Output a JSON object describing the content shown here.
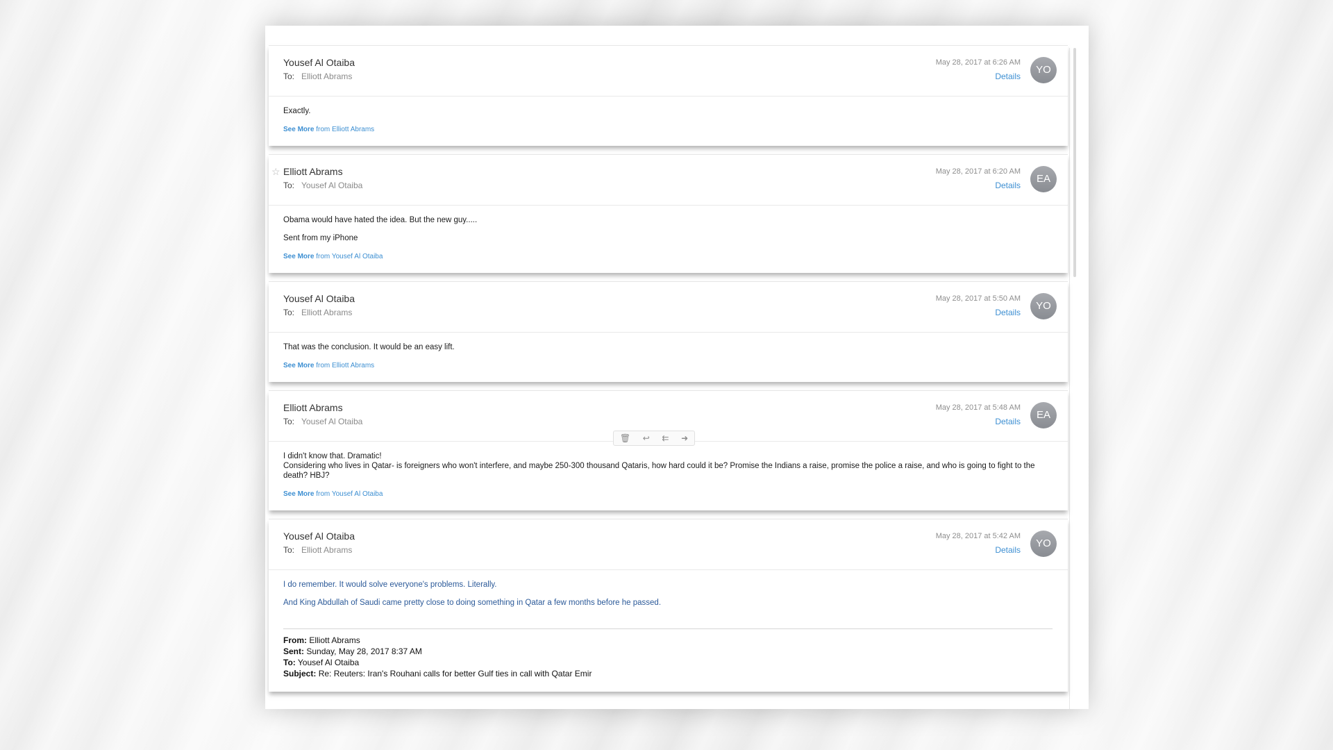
{
  "messages": [
    {
      "sender": "Yousef Al Otaiba",
      "to_label": "To:",
      "to": "Elliott Abrams",
      "date": "May 28, 2017 at 6:26 AM",
      "details": "Details",
      "avatar": "YO",
      "body": [
        "Exactly."
      ],
      "see_more_bold": "See More",
      "see_more_rest": "from Elliott Abrams"
    },
    {
      "sender": "Elliott Abrams",
      "star_icon": "☆",
      "to_label": "To:",
      "to": "Yousef Al Otaiba",
      "date": "May 28, 2017 at 6:20 AM",
      "details": "Details",
      "avatar": "EA",
      "body": [
        "Obama would have hated the idea. But the new guy.....",
        "Sent from my iPhone"
      ],
      "see_more_bold": "See More",
      "see_more_rest": "from Yousef Al Otaiba"
    },
    {
      "sender": "Yousef Al Otaiba",
      "to_label": "To:",
      "to": "Elliott Abrams",
      "date": "May 28, 2017 at 5:50 AM",
      "details": "Details",
      "avatar": "YO",
      "body": [
        "That was the conclusion. It would be an easy lift."
      ],
      "see_more_bold": "See More",
      "see_more_rest": "from Elliott Abrams"
    },
    {
      "sender": "Elliott Abrams",
      "to_label": "To:",
      "to": "Yousef Al Otaiba",
      "date": "May 28, 2017 at 5:48 AM",
      "details": "Details",
      "avatar": "EA",
      "toolbar": {
        "trash_icon": "🗑",
        "reply_icon": "↩",
        "reply_all_icon": "⇇",
        "forward_icon": "➜"
      },
      "body": [
        "I didn't know that. Dramatic!",
        "Considering who lives in Qatar- is foreigners who won't interfere, and maybe 250-300 thousand Qataris, how hard could it be? Promise the Indians a raise, promise the police a raise, and who is going to fight to the death? HBJ?"
      ],
      "see_more_bold": "See More",
      "see_more_rest": "from Yousef Al Otaiba"
    },
    {
      "sender": "Yousef Al Otaiba",
      "to_label": "To:",
      "to": "Elliott Abrams",
      "date": "May 28, 2017 at 5:42 AM",
      "details": "Details",
      "avatar": "YO",
      "body": [
        "I do remember. It would solve everyone's problems. Literally.",
        "And King Abdullah of Saudi came pretty close to doing something in Qatar a few months before he passed."
      ],
      "quote": {
        "from_label": "From:",
        "from": "Elliott Abrams",
        "sent_label": "Sent:",
        "sent": "Sunday, May 28, 2017 8:37 AM",
        "to_label": "To:",
        "to": "Yousef Al Otaiba",
        "subject_label": "Subject:",
        "subject": "Re: Reuters: Iran's Rouhani calls for better Gulf ties in call with Qatar Emir"
      }
    }
  ]
}
